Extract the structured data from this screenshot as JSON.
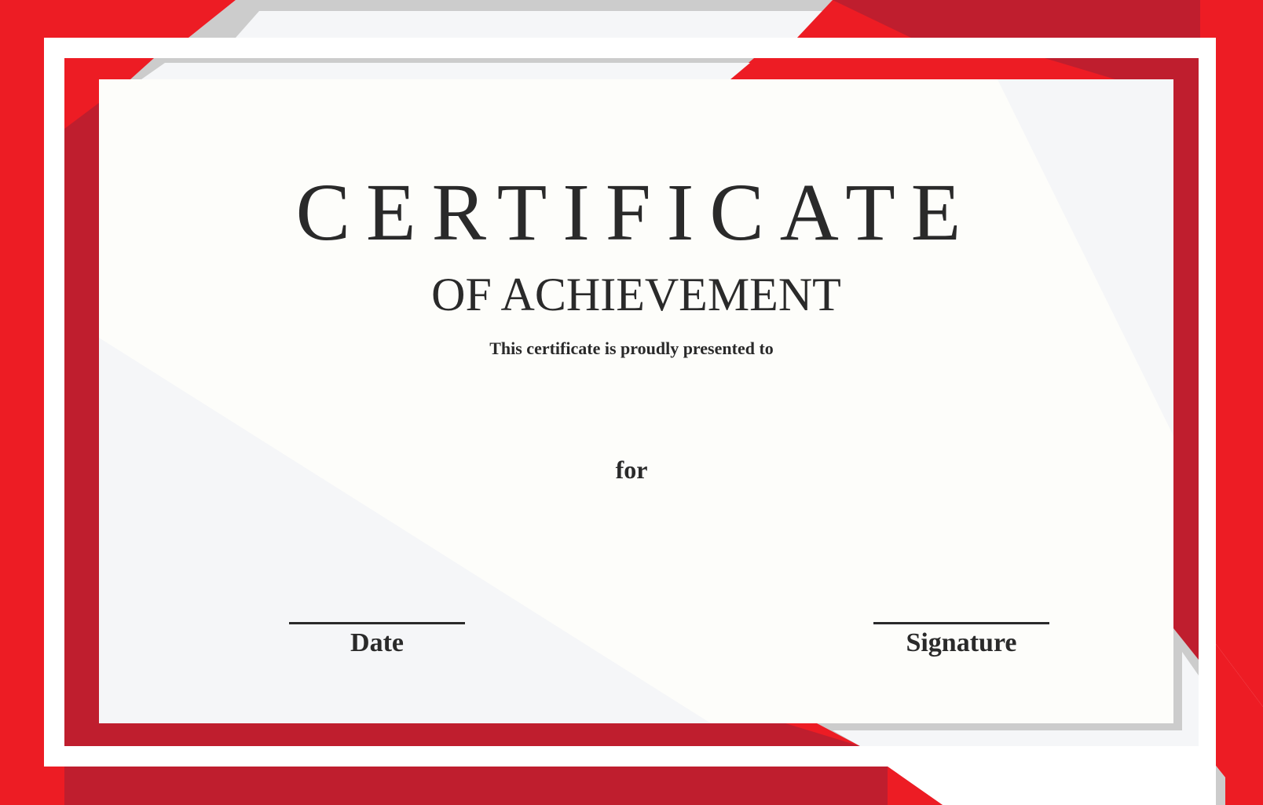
{
  "certificate": {
    "title": "CERTIFICATE",
    "subtitle": "OF ACHIEVEMENT",
    "presented_text": "This certificate is proudly presented to",
    "for_text": "for",
    "date_label": "Date",
    "signature_label": "Signature"
  },
  "colors": {
    "red": "#ED1C24",
    "dark_red": "#BF1E2E",
    "gray": "#CCCCCC",
    "light_gray": "#F5F6F8",
    "paper": "#FDFDFA",
    "white": "#FFFFFF",
    "text": "#2A2A2A"
  }
}
